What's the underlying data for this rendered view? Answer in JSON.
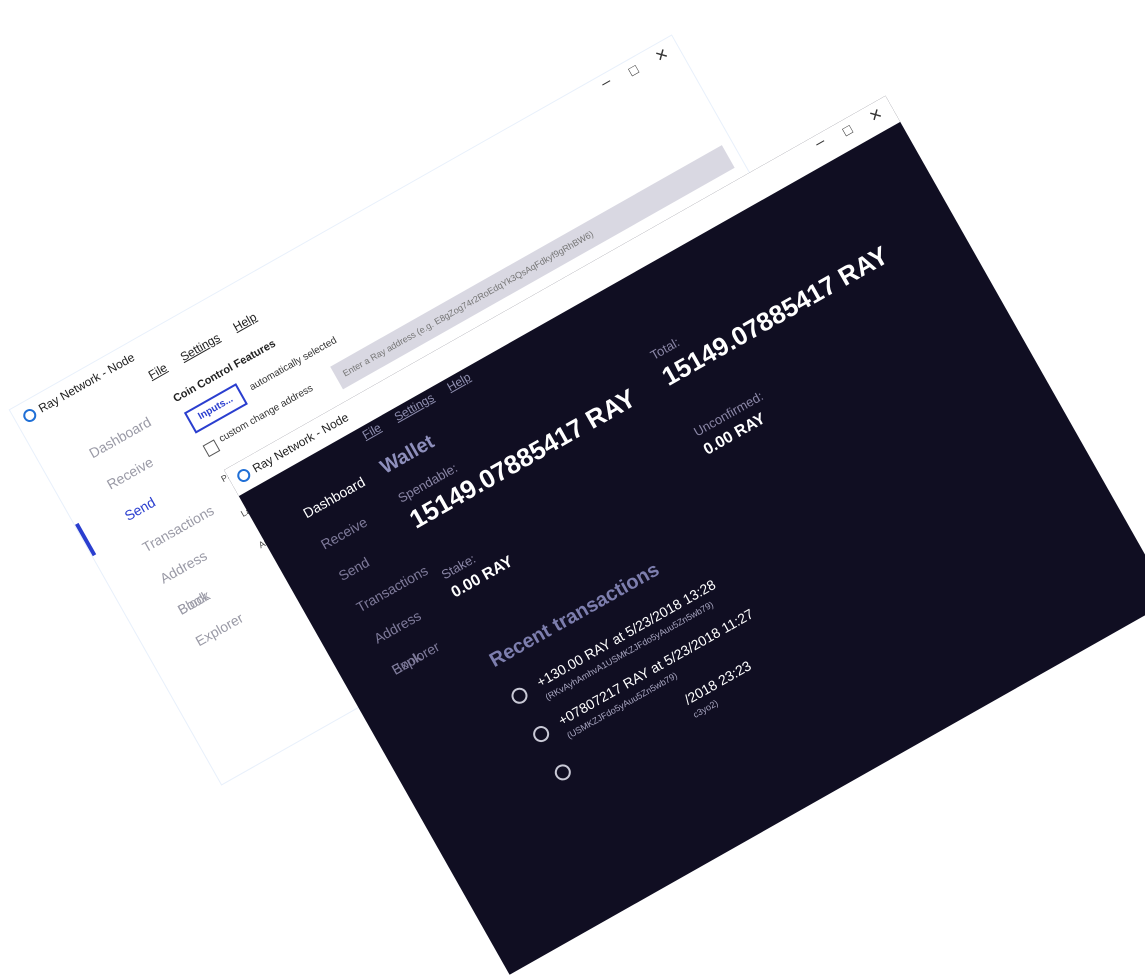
{
  "back_window": {
    "title": "Ray Network - Node",
    "controls": {
      "minimize": "–",
      "maximize": "□",
      "close": "✕"
    },
    "menu": [
      "File",
      "Settings",
      "Help"
    ],
    "sidebar": [
      "Dashboard",
      "Receive",
      "Send",
      "Transactions",
      "Address Book",
      "Block Explorer"
    ],
    "active_item": "Send",
    "coin_control": {
      "title": "Coin Control Features",
      "inputs_button": "Inputs...",
      "selection_status": "automatically selected",
      "custom_change_label": "custom change address"
    },
    "pay_to_placeholder": "Enter a Ray address (e.g. E8gZog74r2RoEdqYk3QsAqFdkyf9gRhBW6)",
    "field_labels": {
      "pay": "Pay",
      "label": "Lab",
      "amount": "Am"
    }
  },
  "front_window": {
    "title": "Ray Network - Node",
    "controls": {
      "minimize": "–",
      "maximize": "□",
      "close": "✕"
    },
    "menu": [
      "File",
      "Settings",
      "Help"
    ],
    "sidebar": [
      "Dashboard",
      "Receive",
      "Send",
      "Transactions",
      "Address Book",
      "Explorer"
    ],
    "active_item": "Dashboard",
    "wallet": {
      "heading": "Wallet",
      "spendable_label": "Spendable:",
      "spendable": "15149.07885417 RAY",
      "stake_label": "Stake:",
      "stake": "0.00 RAY",
      "total_label": "Total:",
      "total": "15149.07885417 RAY",
      "unconfirmed_label": "Unconfirmed:",
      "unconfirmed": "0.00 RAY"
    },
    "recent": {
      "heading": "Recent transactions",
      "transactions": [
        {
          "amount": "+130.00 RAY at 5/23/2018 13:28",
          "address": "(RKvAyhAmhvA1USMKZJFdo5yAuu5Zn5wb79)"
        },
        {
          "amount": "+07807217 RAY at 5/23/2018 11:27",
          "address": "(USMKZJFdo5yAuu5Zn5wb79)"
        },
        {
          "amount": "/2018 23:23",
          "address": "c3yo2)"
        }
      ]
    }
  },
  "colors": {
    "dark_bg": "#100e22",
    "accent": "#2a3ecf",
    "heading_dark": "#8e8fbc",
    "input_bg": "#d9d8e2"
  },
  "icons": [
    "app-logo-icon",
    "minimize-icon",
    "maximize-icon",
    "close-icon",
    "transaction-icon"
  ]
}
